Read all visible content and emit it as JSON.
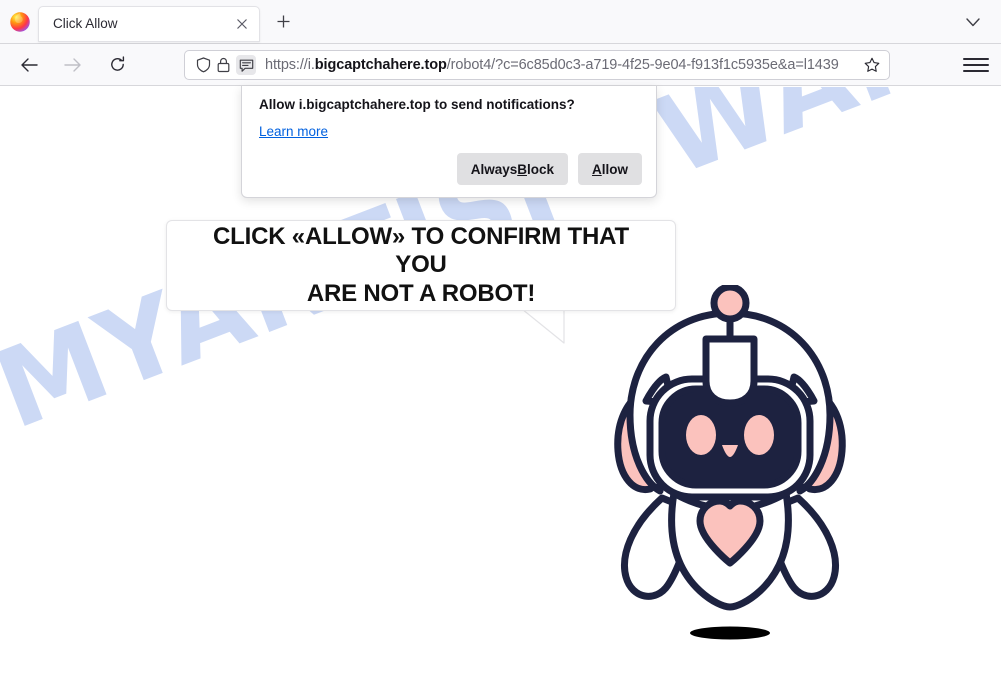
{
  "browser": {
    "app_icon": "firefox-logo-icon",
    "tab": {
      "title": "Click Allow",
      "close_label": "✕"
    },
    "newtab_label": "+",
    "tablist_icon": "chevron-down-icon",
    "nav": {
      "back_icon": "back-arrow-icon",
      "forward_icon": "forward-arrow-icon",
      "reload_icon": "reload-icon"
    },
    "urlbar": {
      "shield_icon": "shield-icon",
      "lock_icon": "lock-icon",
      "notification_icon": "notification-bubble-icon",
      "url_prefix": "https://i.",
      "url_domain": "bigcaptchahere.top",
      "url_path": "/robot4/?c=6c85d0c3-a719-4f25-9e04-f913f1c5935e&a=l1439",
      "bookmark_icon": "star-icon"
    },
    "menu_icon": "hamburger-menu-icon"
  },
  "doorhanger": {
    "title": "Allow i.bigcaptchahere.top to send notifications?",
    "learn_more": "Learn more",
    "always_block_pre": "Always ",
    "always_block_key": "B",
    "always_block_post": "lock",
    "allow_key": "A",
    "allow_post": "llow"
  },
  "page": {
    "bubble_line1": "CLICK «ALLOW» TO CONFIRM THAT YOU",
    "bubble_line2": "ARE NOT A ROBOT!",
    "watermark": "MYANTISPYWARE.COM",
    "robot_alt": "cute-robot-mascot"
  },
  "colors": {
    "navy": "#1d2240",
    "pink": "#fbc2bd",
    "watermark_blue": "#ccd9f5",
    "link_blue": "#0060df",
    "chrome_bg": "#f9f9fb",
    "button_gray": "#e0e0e2"
  }
}
